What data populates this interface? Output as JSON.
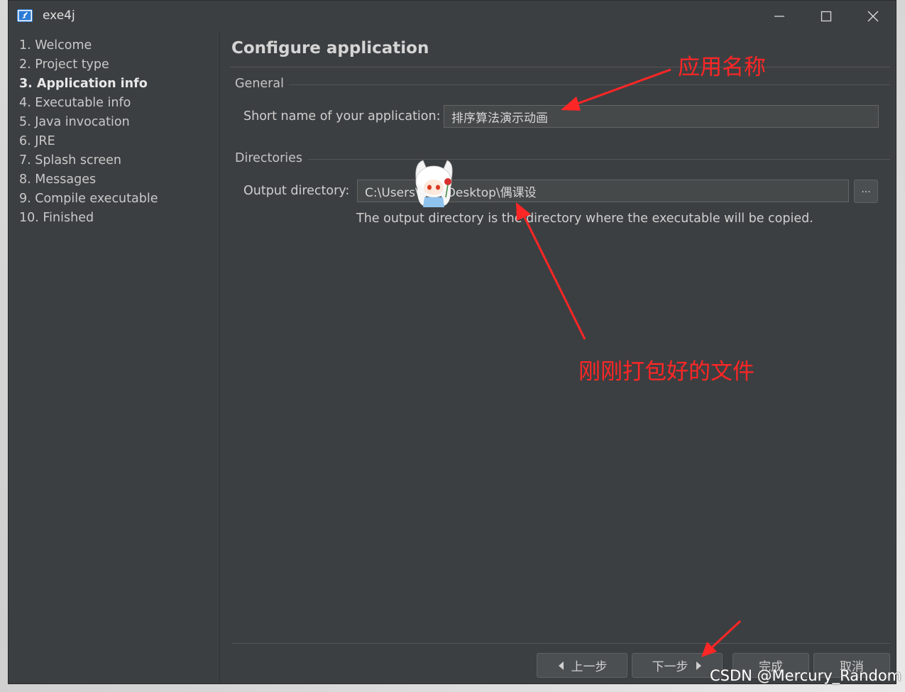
{
  "window": {
    "title": "exe4j"
  },
  "sidebar": {
    "steps": [
      {
        "label": "1. Welcome"
      },
      {
        "label": "2. Project type"
      },
      {
        "label": "3. Application info"
      },
      {
        "label": "4. Executable info"
      },
      {
        "label": "5. Java invocation"
      },
      {
        "label": "6. JRE"
      },
      {
        "label": "7. Splash screen"
      },
      {
        "label": "8. Messages"
      },
      {
        "label": "9. Compile executable"
      },
      {
        "label": "10. Finished"
      }
    ],
    "active_index": 2
  },
  "main": {
    "title": "Configure application",
    "general": {
      "label": "General",
      "short_name_label": "Short name of your application:",
      "short_name_value": "排序算法演示动画"
    },
    "directories": {
      "label": "Directories",
      "output_label": "Output directory:",
      "output_value": "C:\\Users\\      \\Desktop\\偶课设",
      "browse_label": "...",
      "hint": "The output directory is the directory where the executable will be copied."
    }
  },
  "footer": {
    "back_label": "上一步",
    "next_label": "下一步",
    "finish_label": "完成",
    "cancel_label": "取消"
  },
  "annotations": {
    "app_name_note": "应用名称",
    "packaged_file_note": "刚刚打包好的文件",
    "color": "#ff2626"
  },
  "watermark": {
    "text": "CSDN @Mercury_Random"
  },
  "colors": {
    "window_bg": "#3c3f41",
    "field_bg": "#45494a",
    "accent_icon": "#2d7bd6"
  }
}
